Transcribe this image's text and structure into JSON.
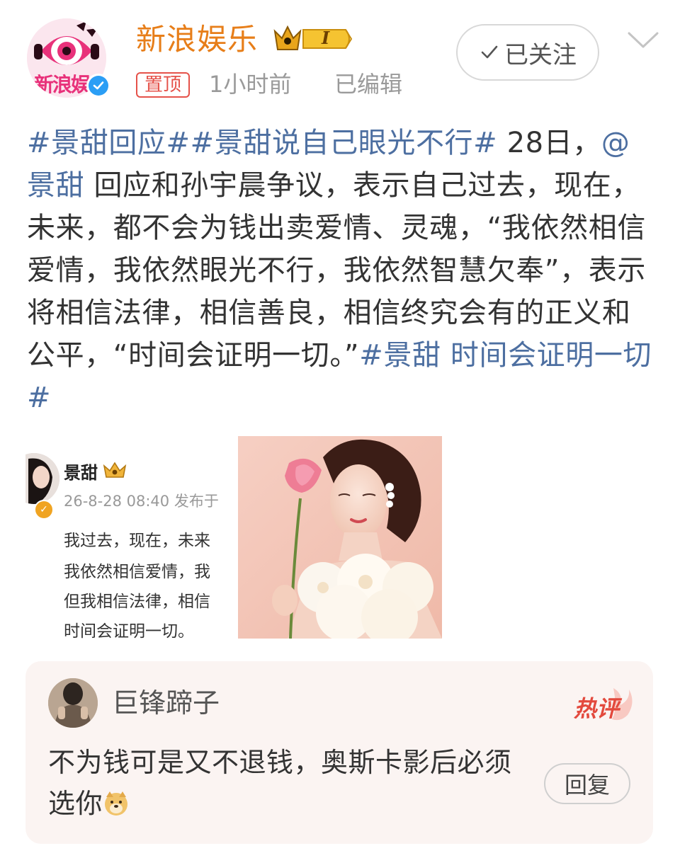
{
  "header": {
    "author_name": "新浪娱乐",
    "avatar_text": "新浪娱",
    "vip_level": "I",
    "pinned_label": "置顶",
    "time": "1小时前",
    "edited": "已编辑",
    "follow_label": "已关注",
    "icons": {
      "verified": "verified-icon",
      "vip": "vip-crown-icon",
      "follow_check": "check-icon",
      "more": "chevron-down-icon"
    },
    "colors": {
      "name": "#e77e19",
      "pin": "#e5524a",
      "verified": "#2b9ef5"
    }
  },
  "post": {
    "tag1": "#景甜回应#",
    "tag2": "#景甜说自己眼光不行#",
    "text1": " 28日，",
    "mention": "@景甜",
    "text2": " 回应和孙宇晨争议，表示自己过去，现在，未来，都不会为钱出卖爱情、灵魂，“我依然相信爱情，我依然眼光不行，我依然智慧欠奉”，表示将相信法律，相信善良，相信终究会有的正义和公平，“时间会证明一切。”",
    "tag3": "#景甜 时间会证明一切#",
    "link_color": "#4d6fa1"
  },
  "screenshot": {
    "name": "景甜",
    "meta": "26-8-28 08:40 发布于",
    "lines": [
      "我过去，现在，未来",
      "我依然相信爱情，我",
      "但我相信法律，相信",
      "时间会证明一切。"
    ]
  },
  "comment": {
    "user": "巨锋蹄子",
    "badge": "热评",
    "text": "不为钱可是又不退钱，奥斯卡影后必须选你",
    "emoji": "doge-emoji",
    "reply_label": "回复"
  }
}
